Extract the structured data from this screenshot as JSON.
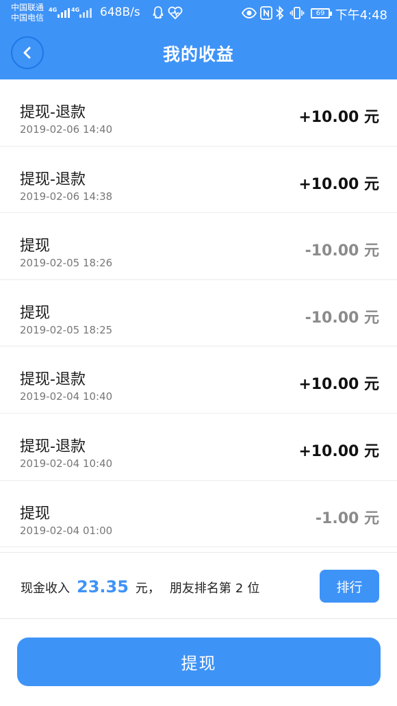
{
  "status_bar": {
    "carrier_1": "中国联通",
    "carrier_2": "中国电信",
    "net_1": "4G",
    "net_2": "4G",
    "net_speed": "648B/s",
    "battery": "69",
    "time": "下午4:48",
    "icons": [
      "qq-icon",
      "heart-rate-icon",
      "eye-icon",
      "nfc-icon",
      "bluetooth-icon",
      "vibrate-icon"
    ]
  },
  "header": {
    "title": "我的收益",
    "back_icon": "chevron-left-icon"
  },
  "transactions": [
    {
      "title": "提现-退款",
      "time": "2019-02-06 14:40",
      "amount": "+10.00 元",
      "kind": "positive"
    },
    {
      "title": "提现-退款",
      "time": "2019-02-06 14:38",
      "amount": "+10.00 元",
      "kind": "positive"
    },
    {
      "title": "提现",
      "time": "2019-02-05 18:26",
      "amount": "-10.00 元",
      "kind": "negative"
    },
    {
      "title": "提现",
      "time": "2019-02-05 18:25",
      "amount": "-10.00 元",
      "kind": "negative"
    },
    {
      "title": "提现-退款",
      "time": "2019-02-04 10:40",
      "amount": "+10.00 元",
      "kind": "positive"
    },
    {
      "title": "提现-退款",
      "time": "2019-02-04 10:40",
      "amount": "+10.00 元",
      "kind": "positive"
    },
    {
      "title": "提现",
      "time": "2019-02-04 01:00",
      "amount": "-1.00 元",
      "kind": "negative"
    }
  ],
  "summary": {
    "label": "现金收入",
    "amount": "23.35",
    "unit": "元，",
    "rank_prefix": "朋友排名第",
    "rank": "2",
    "rank_suffix": "位",
    "rank_button": "排行"
  },
  "actions": {
    "withdraw_button": "提现"
  },
  "colors": {
    "brand": "#3e93f7",
    "positive_amount": "#111111",
    "negative_amount": "#8b8b8b"
  }
}
